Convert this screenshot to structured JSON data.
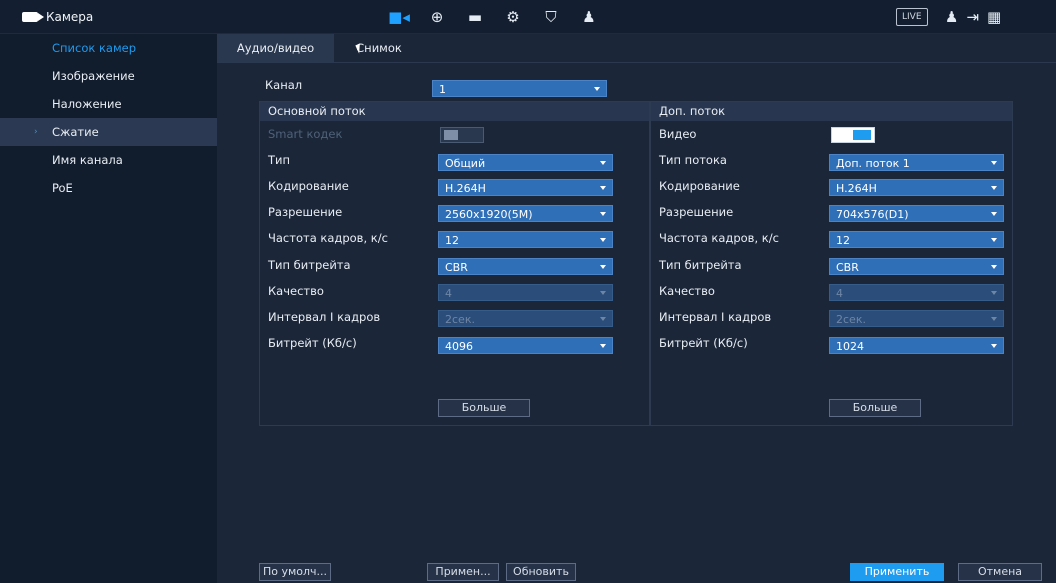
{
  "app": {
    "title": "Камера"
  },
  "topbar": {
    "icons": [
      {
        "icon": "camera-icon",
        "glyph": "■◂",
        "active": true
      },
      {
        "icon": "network-globe-icon",
        "glyph": "⊕",
        "active": false
      },
      {
        "icon": "storage-icon",
        "glyph": "▬",
        "active": false
      },
      {
        "icon": "system-settings-icon",
        "glyph": "⚙",
        "active": false
      },
      {
        "icon": "security-shield-icon",
        "glyph": "⛉",
        "active": false
      },
      {
        "icon": "account-icon",
        "glyph": "♟",
        "active": false
      }
    ],
    "live_label": "LIVE",
    "right_icons": [
      {
        "icon": "user-icon",
        "glyph": "♟"
      },
      {
        "icon": "logout-icon",
        "glyph": "⇥"
      },
      {
        "icon": "qr-code-icon",
        "glyph": "▦"
      }
    ]
  },
  "sidebar": {
    "items": [
      {
        "label": "Список камер",
        "state": "active"
      },
      {
        "label": "Изображение",
        "state": ""
      },
      {
        "label": "Наложение",
        "state": ""
      },
      {
        "label": "Сжатие",
        "state": "selected"
      },
      {
        "label": "Имя канала",
        "state": ""
      },
      {
        "label": "PoE",
        "state": ""
      }
    ]
  },
  "tabs": [
    {
      "label": "Аудио/видео",
      "active": true
    },
    {
      "label": "Снимок",
      "active": false
    }
  ],
  "channel": {
    "label": "Канал",
    "value": "1"
  },
  "main_stream": {
    "header": "Основной поток",
    "smart_codec_label": "Smart кодек",
    "type_label": "Тип",
    "type_value": "Общий",
    "encoding_label": "Кодирование",
    "encoding_value": "H.264H",
    "resolution_label": "Разрешение",
    "resolution_value": "2560x1920(5M)",
    "fps_label": "Частота кадров, к/с",
    "fps_value": "12",
    "bitrate_type_label": "Тип битрейта",
    "bitrate_type_value": "CBR",
    "quality_label": "Качество",
    "quality_value": "4",
    "iframe_label": "Интервал I кадров",
    "iframe_value": "2сек.",
    "bitrate_label": "Битрейт (Кб/с)",
    "bitrate_value": "4096",
    "more_label": "Больше"
  },
  "sub_stream": {
    "header": "Доп. поток",
    "video_label": "Видео",
    "stream_type_label": "Тип потока",
    "stream_type_value": "Доп. поток 1",
    "encoding_label": "Кодирование",
    "encoding_value": "H.264H",
    "resolution_label": "Разрешение",
    "resolution_value": "704x576(D1)",
    "fps_label": "Частота кадров, к/с",
    "fps_value": "12",
    "bitrate_type_label": "Тип битрейта",
    "bitrate_type_value": "CBR",
    "quality_label": "Качество",
    "quality_value": "4",
    "iframe_label": "Интервал I кадров",
    "iframe_value": "2сек.",
    "bitrate_label": "Битрейт (Кб/с)",
    "bitrate_value": "1024",
    "more_label": "Больше"
  },
  "footer": {
    "default_label": "По умолч...",
    "copy_label": "Примен...",
    "refresh_label": "Обновить",
    "apply_label": "Применить",
    "cancel_label": "Отмена"
  }
}
